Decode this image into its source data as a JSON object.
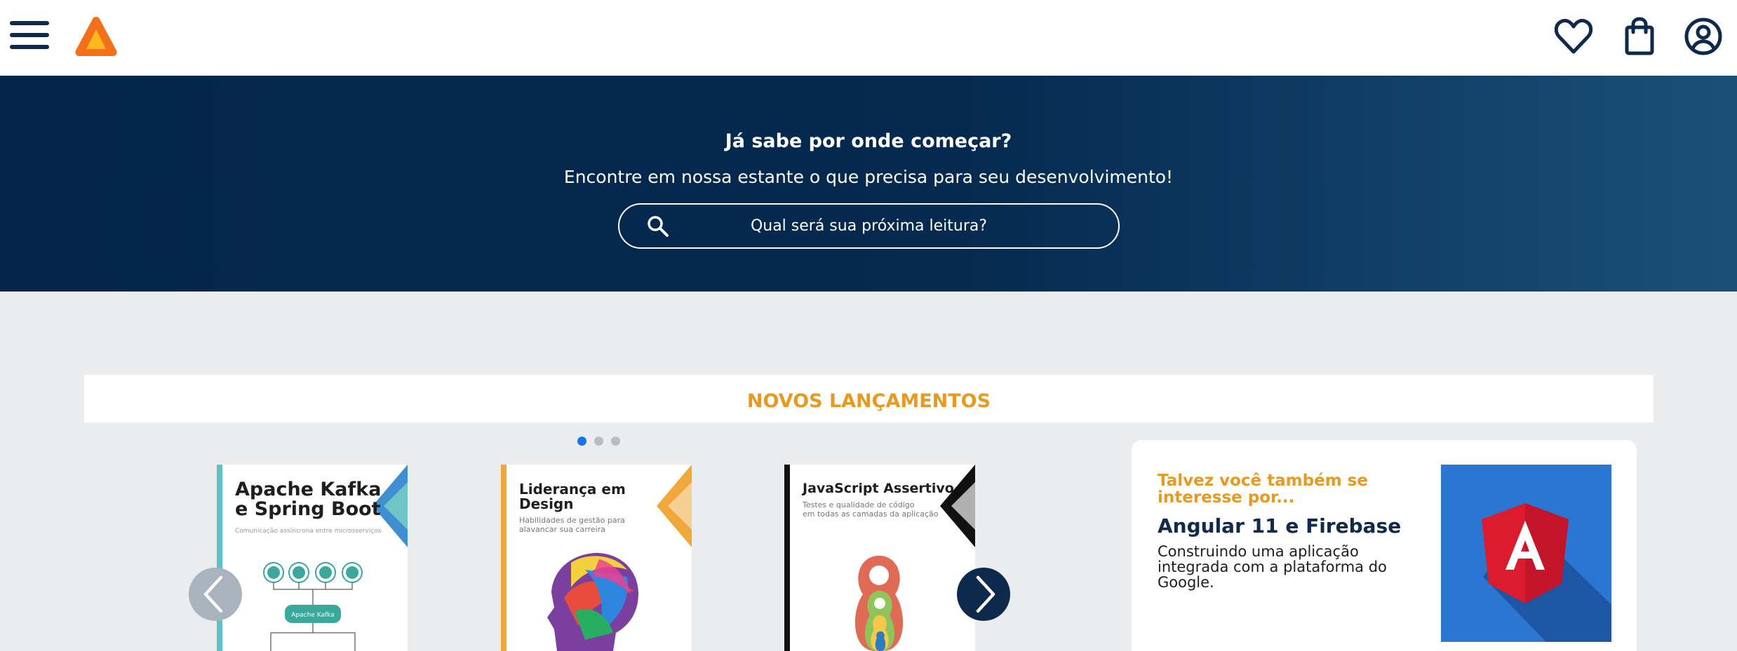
{
  "header": {
    "menu_icon": "hamburger-menu-icon",
    "logo_icon": "brand-logo-triangle",
    "actions": [
      {
        "name": "favorites",
        "icon": "heart-icon"
      },
      {
        "name": "cart",
        "icon": "shopping-bag-icon"
      },
      {
        "name": "account",
        "icon": "user-circle-icon"
      }
    ]
  },
  "hero": {
    "title": "Já sabe por onde começar?",
    "subtitle": "Encontre em nossa estante o que precisa para seu desenvolvimento!",
    "search": {
      "placeholder": "Qual será sua próxima leitura?",
      "icon": "search-icon"
    }
  },
  "new_releases": {
    "title": "NOVOS LANÇAMENTOS",
    "dots_count": 3,
    "active_dot": 1,
    "books": [
      {
        "title_line1": "Apache Kafka",
        "title_line2": "e Spring Boot",
        "subtitle": "Comunicação assíncrona entre microsserviços",
        "badge": "Apache Kafka",
        "accent": "#4aa8d8"
      },
      {
        "title_line1": "Liderança em",
        "title_line2": "Design",
        "subtitle_line1": "Habilidades de gestão para",
        "subtitle_line2": "alavancar sua carreira",
        "accent": "#f0a83a"
      },
      {
        "title_line1": "JavaScript Assertivo",
        "subtitle_line1": "Testes e qualidade de código",
        "subtitle_line2": "em todas as camadas da aplicação",
        "accent": "#111111"
      }
    ],
    "prev_icon": "chevron-left-icon",
    "next_icon": "chevron-right-icon"
  },
  "suggestion": {
    "kicker": "Talvez você também se interesse por...",
    "title": "Angular 11 e Firebase",
    "description": "Construindo uma aplicação integrada com a plataforma do Google.",
    "cover_icon": "angular-logo"
  },
  "colors": {
    "navy": "#0d2a4d",
    "hero_start": "#03264a",
    "hero_end": "#1a5078",
    "accent_orange": "#e79a22",
    "background": "#ebecee",
    "active_dot": "#1a73e8"
  }
}
